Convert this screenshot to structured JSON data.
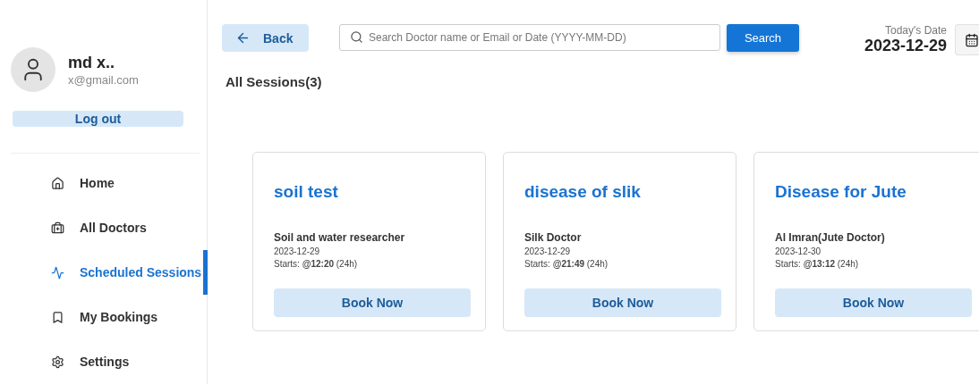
{
  "user": {
    "name": "md x..",
    "email": "x@gmail.com"
  },
  "logout_button": "Log out",
  "nav": [
    {
      "label": "Home",
      "selected": false
    },
    {
      "label": "All Doctors",
      "selected": false
    },
    {
      "label": "Scheduled Sessions",
      "selected": true
    },
    {
      "label": "My Bookings",
      "selected": false
    },
    {
      "label": "Settings",
      "selected": false
    }
  ],
  "back_button": "Back",
  "search": {
    "placeholder": "Search Doctor name or Email or Date (YYYY-MM-DD)",
    "button": "Search"
  },
  "today": {
    "label": "Today's Date",
    "date": "2023-12-29"
  },
  "heading": "All Sessions(3)",
  "sessions": [
    {
      "title": "soil test",
      "doctor": "Soil and water researcher",
      "date": "2023-12-29",
      "starts": "Starts: **@12:20** (24h)",
      "button": "Book Now"
    },
    {
      "title": "disease of slik",
      "doctor": "Silk Doctor",
      "date": "2023-12-29",
      "starts": "Starts: **@21:49** (24h)",
      "button": "Book Now"
    },
    {
      "title": "Disease for Jute",
      "doctor": "Al Imran(Jute Doctor)",
      "date": "2023-12-30",
      "starts": "Starts: **@13:12** (24h)",
      "button": "Book Now"
    }
  ]
}
